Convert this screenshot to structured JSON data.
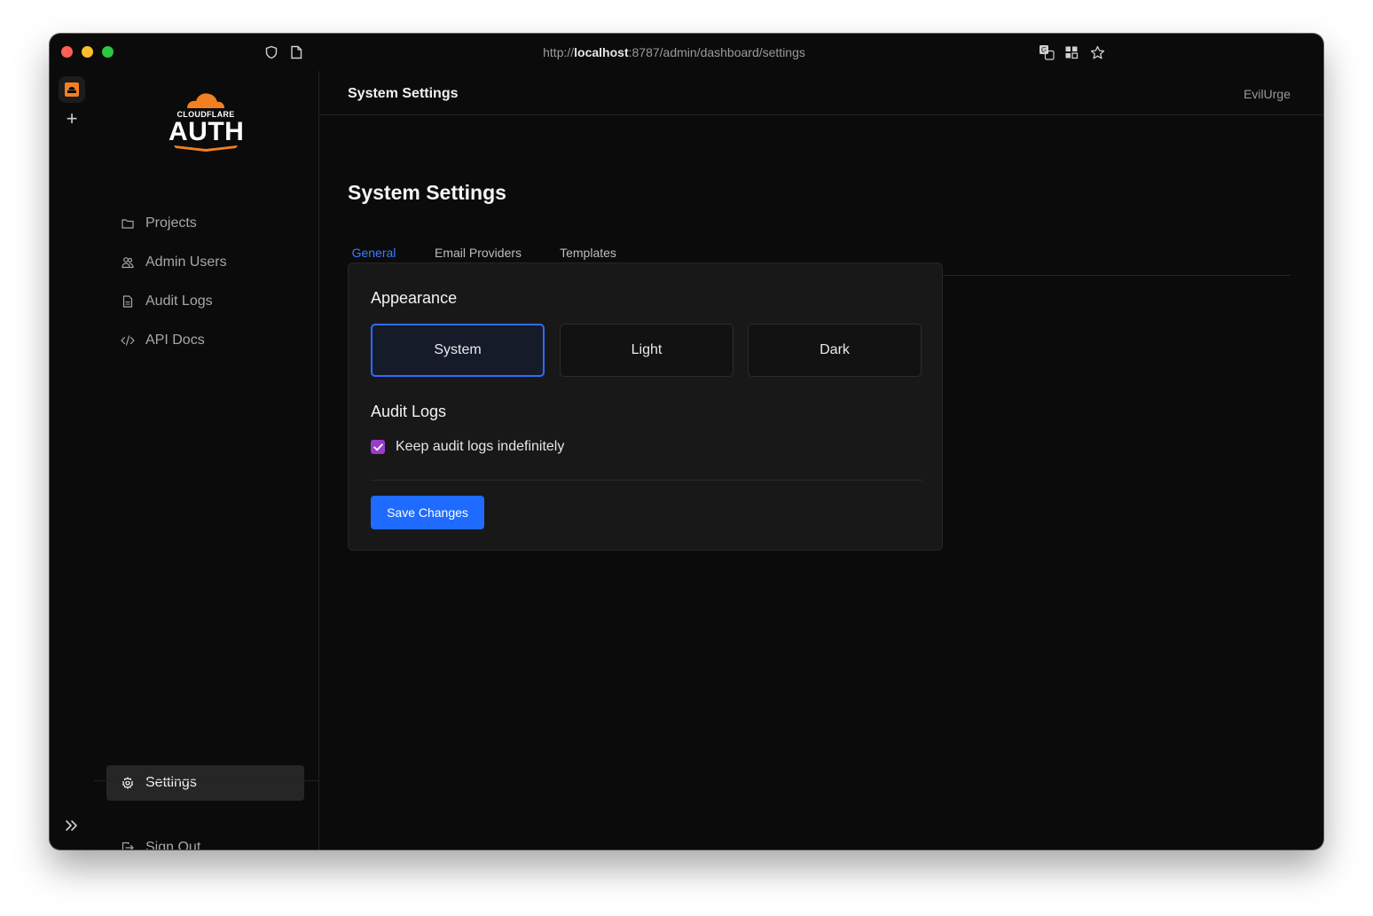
{
  "browser": {
    "url_prefix": "http://",
    "url_host": "localhost",
    "url_rest": ":8787/admin/dashboard/settings"
  },
  "brand": {
    "logo_sub": "CLOUDFLARE",
    "logo_main": "AUTH",
    "accent": "#f38020"
  },
  "sidebar": {
    "items": [
      {
        "label": "Projects",
        "icon": "folder-icon"
      },
      {
        "label": "Admin Users",
        "icon": "users-icon"
      },
      {
        "label": "Audit Logs",
        "icon": "file-text-icon"
      },
      {
        "label": "API Docs",
        "icon": "code-icon"
      }
    ],
    "settings_label": "Settings",
    "signout_label": "Sign Out"
  },
  "header": {
    "title": "System Settings",
    "user": "EvilUrge"
  },
  "main": {
    "page_title": "System Settings",
    "tabs": [
      {
        "label": "General",
        "active": true
      },
      {
        "label": "Email Providers",
        "active": false
      },
      {
        "label": "Templates",
        "active": false
      }
    ],
    "appearance": {
      "heading": "Appearance",
      "options": [
        "System",
        "Light",
        "Dark"
      ],
      "selected": "System"
    },
    "audit": {
      "heading": "Audit Logs",
      "keep_label": "Keep audit logs indefinitely",
      "keep_checked": true
    },
    "save_label": "Save Changes"
  },
  "colors": {
    "primary": "#1f6bff",
    "checkbox": "#9b3cc8",
    "background": "#0b0b0b"
  }
}
